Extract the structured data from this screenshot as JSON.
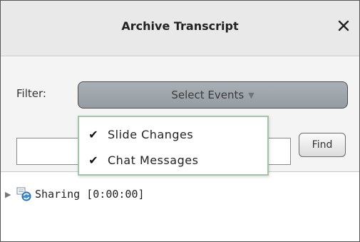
{
  "window": {
    "title": "Archive Transcript",
    "close_symbol": "✕"
  },
  "filter": {
    "label": "Filter:",
    "select_label": "Select Events",
    "select_arrow": "▼"
  },
  "dropdown": {
    "items": [
      {
        "check": "✔",
        "label": "Slide Changes"
      },
      {
        "check": "✔",
        "label": "Chat Messages"
      }
    ]
  },
  "search": {
    "value": "",
    "placeholder": "",
    "find_label": "Find"
  },
  "tree": {
    "items": [
      {
        "expander": "▶",
        "icon": "sharing-icon",
        "label": "Sharing [0:00:00]"
      }
    ]
  },
  "colors": {
    "titlebar_bg": "#e9e9e9",
    "panel_bg": "#f4f4f4",
    "select_bg": "#a3aaaf",
    "dropdown_border": "#9ec6a6"
  }
}
